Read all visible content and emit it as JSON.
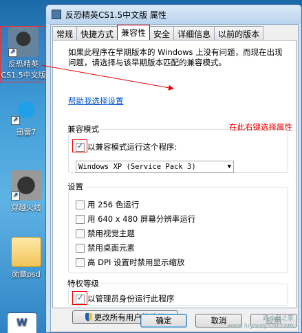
{
  "desktop": {
    "icons": [
      {
        "label": "反恐精英CS1.5中文版"
      },
      {
        "label": "迅雷7"
      },
      {
        "label": "穿越火线"
      },
      {
        "label": "勋章psd"
      },
      {
        "label": "W"
      }
    ]
  },
  "window": {
    "title": "反恐精英CS1.5中文版 属性",
    "tabs": [
      {
        "label": "常规"
      },
      {
        "label": "快捷方式"
      },
      {
        "label": "兼容性"
      },
      {
        "label": "安全"
      },
      {
        "label": "详细信息"
      },
      {
        "label": "以前的版本"
      }
    ],
    "active_tab": "兼容性",
    "description": "如果此程序在早期版本的 Windows 上没有问题，而现在出现问题，请选择与该早期版本匹配的兼容模式。",
    "help_link": "帮助我选择设置",
    "annotation": "在此右键选择属性",
    "compat_group": {
      "legend": "兼容模式",
      "checkbox_label": "以兼容模式运行这个程序:",
      "checked": true,
      "selected_os": "Windows XP (Service Pack 3)"
    },
    "settings_group": {
      "legend": "设置",
      "options": [
        {
          "label": "用 256 色运行",
          "checked": false
        },
        {
          "label": "用 640 x 480 屏幕分辨率运行",
          "checked": false
        },
        {
          "label": "禁用视觉主题",
          "checked": false
        },
        {
          "label": "禁用桌面元素",
          "checked": false
        },
        {
          "label": "高 DPI 设置时禁用显示缩放",
          "checked": false
        }
      ]
    },
    "privilege_group": {
      "legend": "特权等级",
      "checkbox_label": "以管理员身份运行此程序",
      "checked": true
    },
    "buttons": {
      "all_users": "更改所有用户的设置",
      "ok": "确定",
      "cancel": "取消",
      "apply": "应用"
    },
    "watermark": {
      "line1": "路由器之家",
      "line2": "www.luyouqi520.com"
    }
  }
}
